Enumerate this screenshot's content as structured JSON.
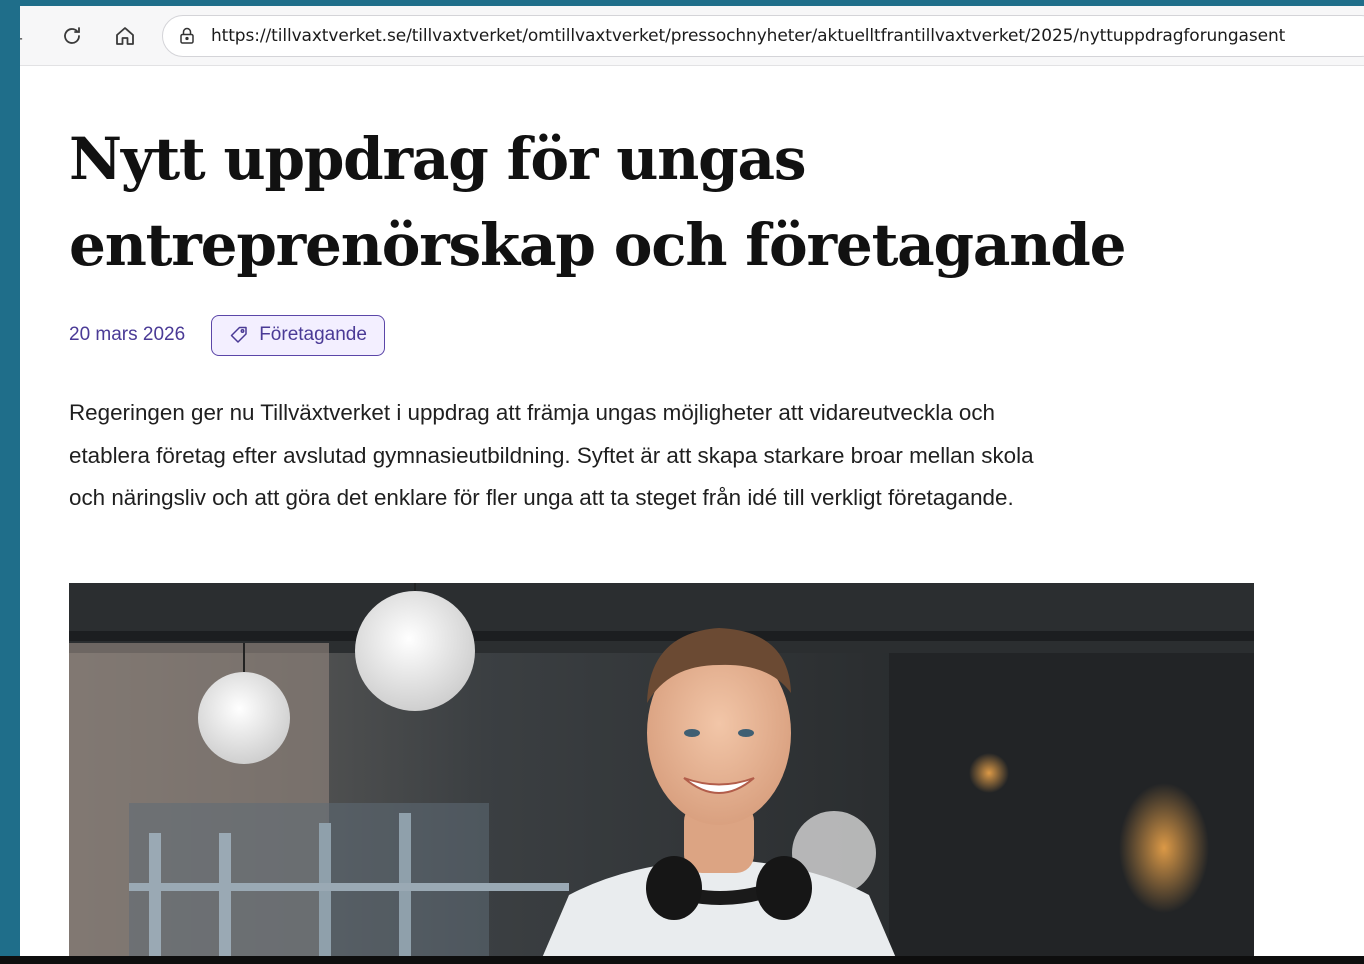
{
  "browser": {
    "url": "https://tillvaxtverket.se/tillvaxtverket/omtillvaxtverket/pressochnyheter/aktuelltfrantillvaxtverket/2025/nyttuppdragforungasent",
    "icons": [
      "reload-icon",
      "home-icon",
      "site-info-icon"
    ]
  },
  "article": {
    "headline_line1": "Nytt uppdrag för ungas",
    "headline_line2": "entreprenörskap och företagande",
    "date": "20 mars 2026",
    "tag_label": "Företagande",
    "lead_line1": "Regeringen ger nu Tillväxtverket i uppdrag att främja ungas möjligheter att vidareutveckla och",
    "lead_line2": "etablera företag efter avslutad gymnasieutbildning. Syftet är att skapa starkare broar mellan skola",
    "lead_line3": "och näringsliv och att göra det enklare för fler unga att ta steget från idé till verkligt företagande."
  },
  "colors": {
    "accent": "#4a3a96",
    "tag_bg": "#f3efff",
    "desktop": "#1f6e8a"
  }
}
